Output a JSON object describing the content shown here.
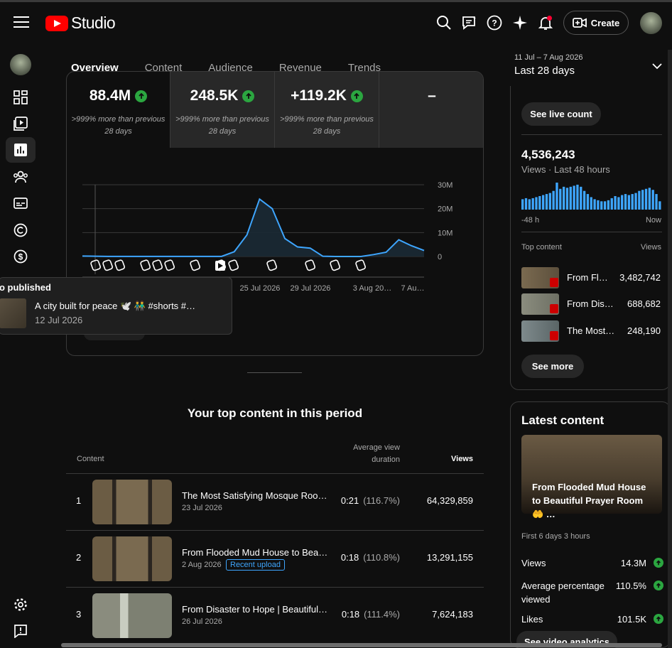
{
  "header": {
    "app_name": "Studio",
    "create_label": "Create"
  },
  "tabs": [
    "Overview",
    "Content",
    "Audience",
    "Revenue",
    "Trends"
  ],
  "date_range": {
    "dates": "11 Jul – 7 Aug 2026",
    "label": "Last 28 days"
  },
  "metrics": [
    {
      "value": "88.4M",
      "sub": ">999% more than previous 28 days"
    },
    {
      "value": "248.5K",
      "sub": ">999% more than previous 28 days"
    },
    {
      "value": "+119.2K",
      "sub": ">999% more than previous 28 days"
    },
    {
      "value": "–",
      "sub": ""
    }
  ],
  "chart_data": {
    "type": "line",
    "x_tick_labels": [
      "25 Jul 2026",
      "29 Jul 2026",
      "3 Aug 20…",
      "7 Au…"
    ],
    "y_tick_labels": [
      "30M",
      "20M",
      "10M",
      "0"
    ],
    "ylim": [
      0,
      30000000
    ],
    "values": [
      0.2,
      0.1,
      0.05,
      0.05,
      0.05,
      0.05,
      0.05,
      0.05,
      0.05,
      0.05,
      0.05,
      0.05,
      2,
      9,
      24,
      20,
      7.5,
      4,
      3.5,
      0.1,
      0,
      0,
      0,
      0.8,
      1.8,
      7,
      4.5,
      2.5
    ],
    "grid": true,
    "color": "#3ea6ff"
  },
  "tooltip": {
    "title": "o published",
    "video": "A city built for peace 🕊️ 👬 #shorts #…",
    "date": "12 Jul 2026"
  },
  "top_content": {
    "title": "Your top content in this period",
    "headers": {
      "content": "Content",
      "avd": "Average view duration",
      "views": "Views"
    },
    "rows": [
      {
        "rank": "1",
        "title": "The Most Satisfying Mosque Roo…",
        "date": "23 Jul 2026",
        "badge": "",
        "avd": "0:21",
        "pct": "(116.7%)",
        "views": "64,329,859"
      },
      {
        "rank": "2",
        "title": "From Flooded Mud House to Bea…",
        "date": "2 Aug 2026",
        "badge": "Recent upload",
        "avd": "0:18",
        "pct": "(110.8%)",
        "views": "13,291,155"
      },
      {
        "rank": "3",
        "title": "From Disaster to Hope | Beautiful…",
        "date": "26 Jul 2026",
        "badge": "",
        "avd": "0:18",
        "pct": "(111.4%)",
        "views": "7,624,183"
      }
    ]
  },
  "realtime": {
    "live_count_label": "See live count",
    "views": "4,536,243",
    "views_label": "Views · Last 48 hours",
    "axis_start": "-48 h",
    "axis_end": "Now",
    "top_content_label": "Top content",
    "views_col": "Views",
    "bars": [
      10,
      11,
      10,
      11,
      12,
      13,
      14,
      15,
      16,
      18,
      26,
      20,
      22,
      21,
      22,
      23,
      24,
      22,
      18,
      15,
      12,
      10,
      9,
      8,
      8,
      9,
      11,
      13,
      12,
      14,
      15,
      14,
      15,
      16,
      18,
      19,
      20,
      21,
      19,
      15,
      8
    ],
    "items": [
      {
        "title": "From Fl…",
        "views": "3,482,742"
      },
      {
        "title": "From Dis…",
        "views": "688,682"
      },
      {
        "title": "The Most…",
        "views": "248,190"
      }
    ],
    "see_more_label": "See more"
  },
  "latest": {
    "title": "Latest content",
    "video_title": "From Flooded Mud House to Beautiful Prayer Room 🤲 …",
    "age": "First 6 days 3 hours",
    "stats": [
      {
        "label": "Views",
        "value": "14.3M"
      },
      {
        "label": "Average percentage viewed",
        "value": "110.5%"
      },
      {
        "label": "Likes",
        "value": "101.5K"
      }
    ],
    "partial_button": "See video analytics"
  }
}
